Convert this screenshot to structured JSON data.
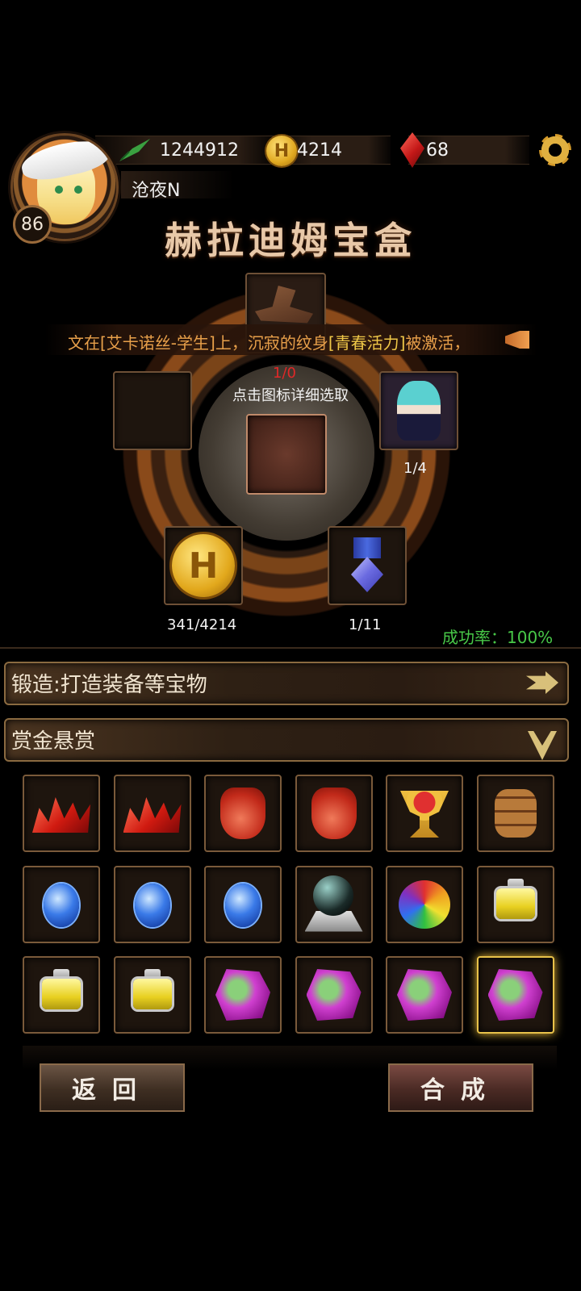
{
  "player": {
    "level": "86",
    "name": "沧夜N",
    "power": "1244912",
    "coins": "4214",
    "gems": "68"
  },
  "title": "赫拉迪姆宝盒",
  "notice": {
    "part1": "文在[艾卡诺丝-学生]上，沉寂的纹身",
    "highlight": "[青春活力]",
    "part2": "被激活，"
  },
  "altar": {
    "center_count": "1/0",
    "hint": "点击图标详细选取",
    "right_count": "1/4",
    "coin_count": "341/4214",
    "medal_count": "1/11",
    "success_rate": "成功率：100%"
  },
  "sections": {
    "forge": "锻造:打造装备等宝物",
    "bounty": "赏金悬赏"
  },
  "items": [
    "red-crystal-icon",
    "red-crystal-icon",
    "red-bag-icon",
    "red-bag-icon",
    "goblet-icon",
    "barrel-icon",
    "sapphire-icon",
    "sapphire-icon",
    "sapphire-icon",
    "dark-orb-icon",
    "rainbow-gem-icon",
    "yellow-bottle-icon",
    "yellow-bottle-icon",
    "yellow-bottle-icon",
    "purple-stone-icon",
    "purple-stone-icon",
    "purple-stone-icon",
    "purple-stone-icon"
  ],
  "buttons": {
    "back": "返回",
    "craft": "合成"
  },
  "colors": {
    "success": "#48c848",
    "notice": "#e8a04a",
    "warning": "#e02828",
    "gold": "#e8c24a"
  }
}
